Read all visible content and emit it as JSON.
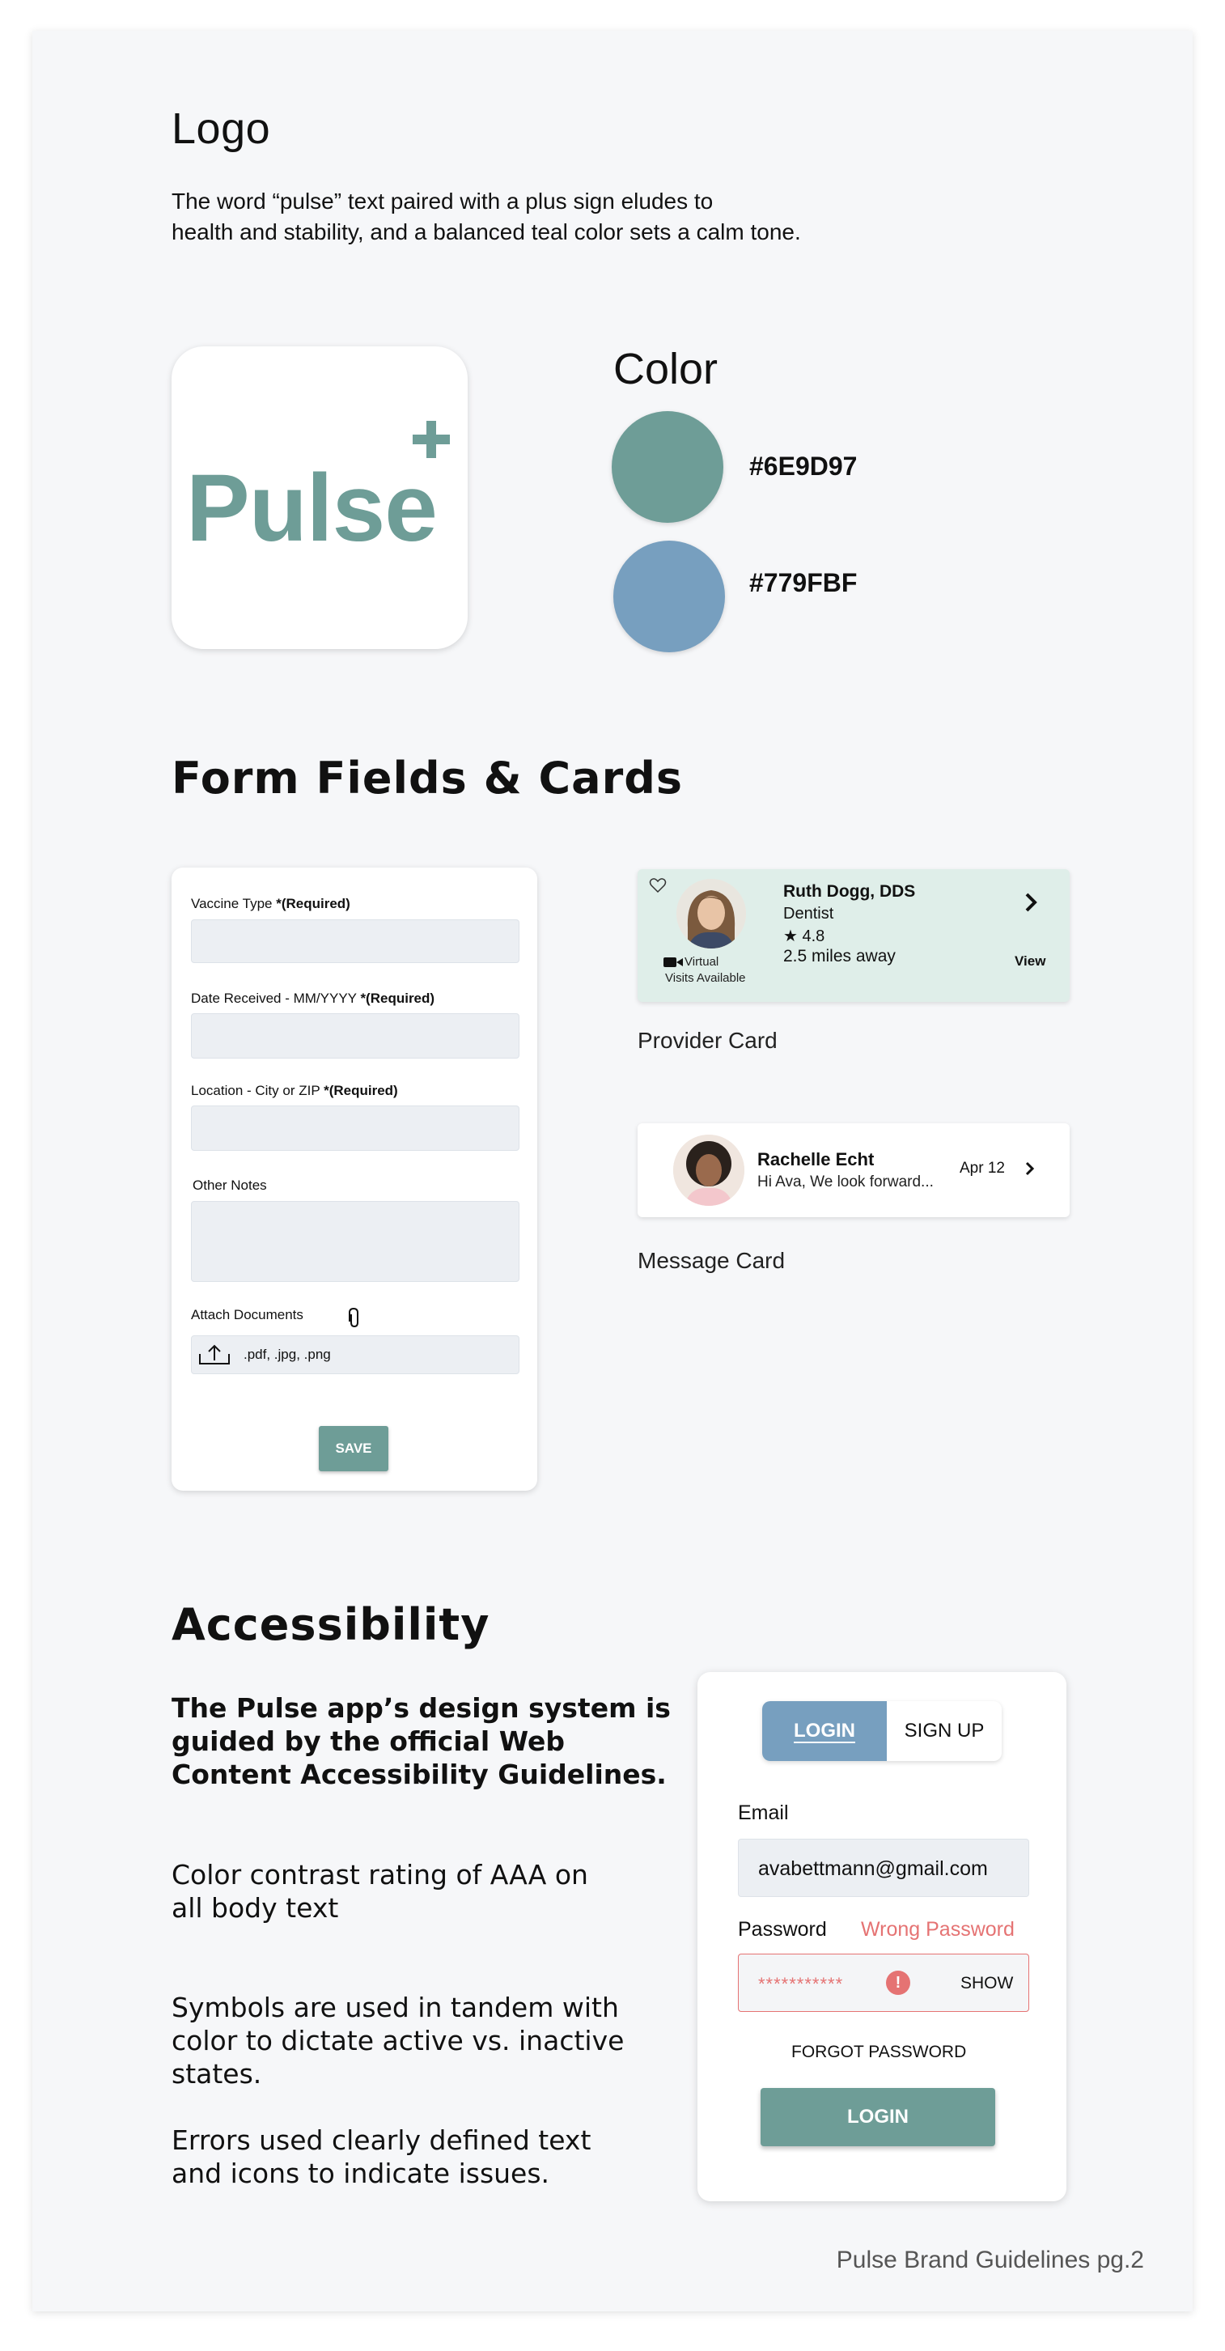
{
  "logo_section": {
    "heading": "Logo",
    "description_line1": "The word “pulse” text paired with a plus sign eludes to",
    "description_line2": "health and stability,  and a balanced teal color sets a calm tone.",
    "logo_word": "Pulse"
  },
  "color_section": {
    "heading": "Color",
    "swatches": [
      {
        "hex": "#6E9D97",
        "color": "#6e9d97"
      },
      {
        "hex": "#779FBF",
        "color": "#779fbf"
      }
    ]
  },
  "forms_section": {
    "heading": "Form Fields & Cards",
    "form": {
      "vaccine_label": "Vaccine Type ",
      "vaccine_required": "*(Required)",
      "date_label": "Date Received - MM/YYYY ",
      "date_required": "*(Required)",
      "location_label": "Location - City or ZIP ",
      "location_required": "*(Required)",
      "notes_label": "Other Notes",
      "attach_label": "Attach Documents",
      "attach_types": ".pdf, .jpg, .png",
      "save_label": "SAVE"
    },
    "provider_card": {
      "name": "Ruth Dogg, DDS",
      "specialty": "Dentist",
      "rating": "4.8",
      "distance": "2.5 miles away",
      "virtual_line1": "Virtual",
      "virtual_line2": "Visits Available",
      "view_label": "View",
      "caption": "Provider Card"
    },
    "message_card": {
      "name": "Rachelle Echt",
      "preview": "Hi Ava, We look forward...",
      "date": "Apr 12",
      "caption": "Message Card"
    }
  },
  "accessibility_section": {
    "heading": "Accessibility",
    "paragraph1": [
      "The Pulse app’s design system is",
      "guided by the official Web",
      "Content Accessibility Guidelines."
    ],
    "paragraph2": [
      "Color contrast rating of AAA on",
      "all body text"
    ],
    "paragraph3": [
      "Symbols are used in tandem with",
      "color to dictate active vs. inactive",
      "states."
    ],
    "paragraph4": [
      "Errors used clearly defined text",
      "and icons to indicate issues."
    ]
  },
  "login_card": {
    "tab_login": "LOGIN",
    "tab_signup": "SIGN UP",
    "email_label": "Email",
    "email_value": "avabettmann@gmail.com",
    "password_label": "Password",
    "password_error": "Wrong Password",
    "password_value": "***********",
    "error_glyph": "!",
    "show_label": "SHOW",
    "forgot_label": "FORGOT PASSWORD",
    "login_button": "LOGIN"
  },
  "footer": "Pulse Brand Guidelines pg.2"
}
